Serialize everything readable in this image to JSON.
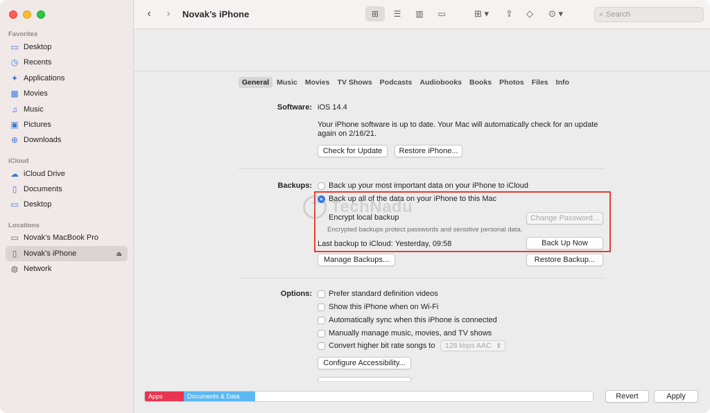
{
  "window": {
    "title": "Novak’s iPhone"
  },
  "sidebar": {
    "sections": [
      {
        "label": "Favorites",
        "items": [
          {
            "label": "Desktop",
            "icon": "desktop-icon"
          },
          {
            "label": "Recents",
            "icon": "clock-icon"
          },
          {
            "label": "Applications",
            "icon": "applications-icon"
          },
          {
            "label": "Movies",
            "icon": "film-icon"
          },
          {
            "label": "Music",
            "icon": "music-note-icon"
          },
          {
            "label": "Pictures",
            "icon": "photo-icon"
          },
          {
            "label": "Downloads",
            "icon": "download-icon"
          }
        ]
      },
      {
        "label": "iCloud",
        "items": [
          {
            "label": "iCloud Drive",
            "icon": "cloud-icon"
          },
          {
            "label": "Documents",
            "icon": "document-icon"
          },
          {
            "label": "Desktop",
            "icon": "desktop-icon"
          }
        ]
      },
      {
        "label": "Locations",
        "items": [
          {
            "label": "Novak’s MacBook Pro",
            "icon": "laptop-icon"
          },
          {
            "label": "Novak’s iPhone",
            "icon": "iphone-icon"
          },
          {
            "label": "Network",
            "icon": "globe-icon"
          }
        ]
      }
    ]
  },
  "toolbar": {
    "search_placeholder": "Search"
  },
  "tabs": [
    "General",
    "Music",
    "Movies",
    "TV Shows",
    "Podcasts",
    "Audiobooks",
    "Books",
    "Photos",
    "Files",
    "Info"
  ],
  "software": {
    "label": "Software:",
    "version": "iOS 14.4",
    "message_line1": "Your iPhone software is up to date. Your Mac will automatically check for an update",
    "message_line2": "again on 2/16/21.",
    "check_button": "Check for Update",
    "restore_button": "Restore iPhone..."
  },
  "backups": {
    "label": "Backups:",
    "option_icloud": "Back up your most important data on your iPhone to iCloud",
    "option_mac": "Back up all of the data on your iPhone to this Mac",
    "encrypt_label": "Encrypt local backup",
    "encrypt_note": "Encrypted backups protect passwords and sensitive personal data.",
    "change_password_button": "Change Password...",
    "last_backup_label": "Last backup to iCloud:",
    "last_backup_value": "Yesterday, 09:58",
    "backup_now_button": "Back Up Now",
    "manage_button": "Manage Backups...",
    "restore_backup_button": "Restore Backup..."
  },
  "options": {
    "label": "Options:",
    "items": [
      "Prefer standard definition videos",
      "Show this iPhone when on Wi-Fi",
      "Automatically sync when this iPhone is connected",
      "Manually manage music, movies, and TV shows",
      "Convert higher bit rate songs to"
    ],
    "bitrate_value": "128 kbps AAC",
    "accessibility_button": "Configure Accessibility..."
  },
  "watermark": {
    "text": "TechNadu"
  },
  "storage": {
    "apps_label": "Apps",
    "docs_label": "Documents & Data",
    "colors": {
      "apps": "#e83550",
      "docs": "#5cb8f2"
    }
  },
  "footer": {
    "revert_button": "Revert",
    "apply_button": "Apply"
  }
}
